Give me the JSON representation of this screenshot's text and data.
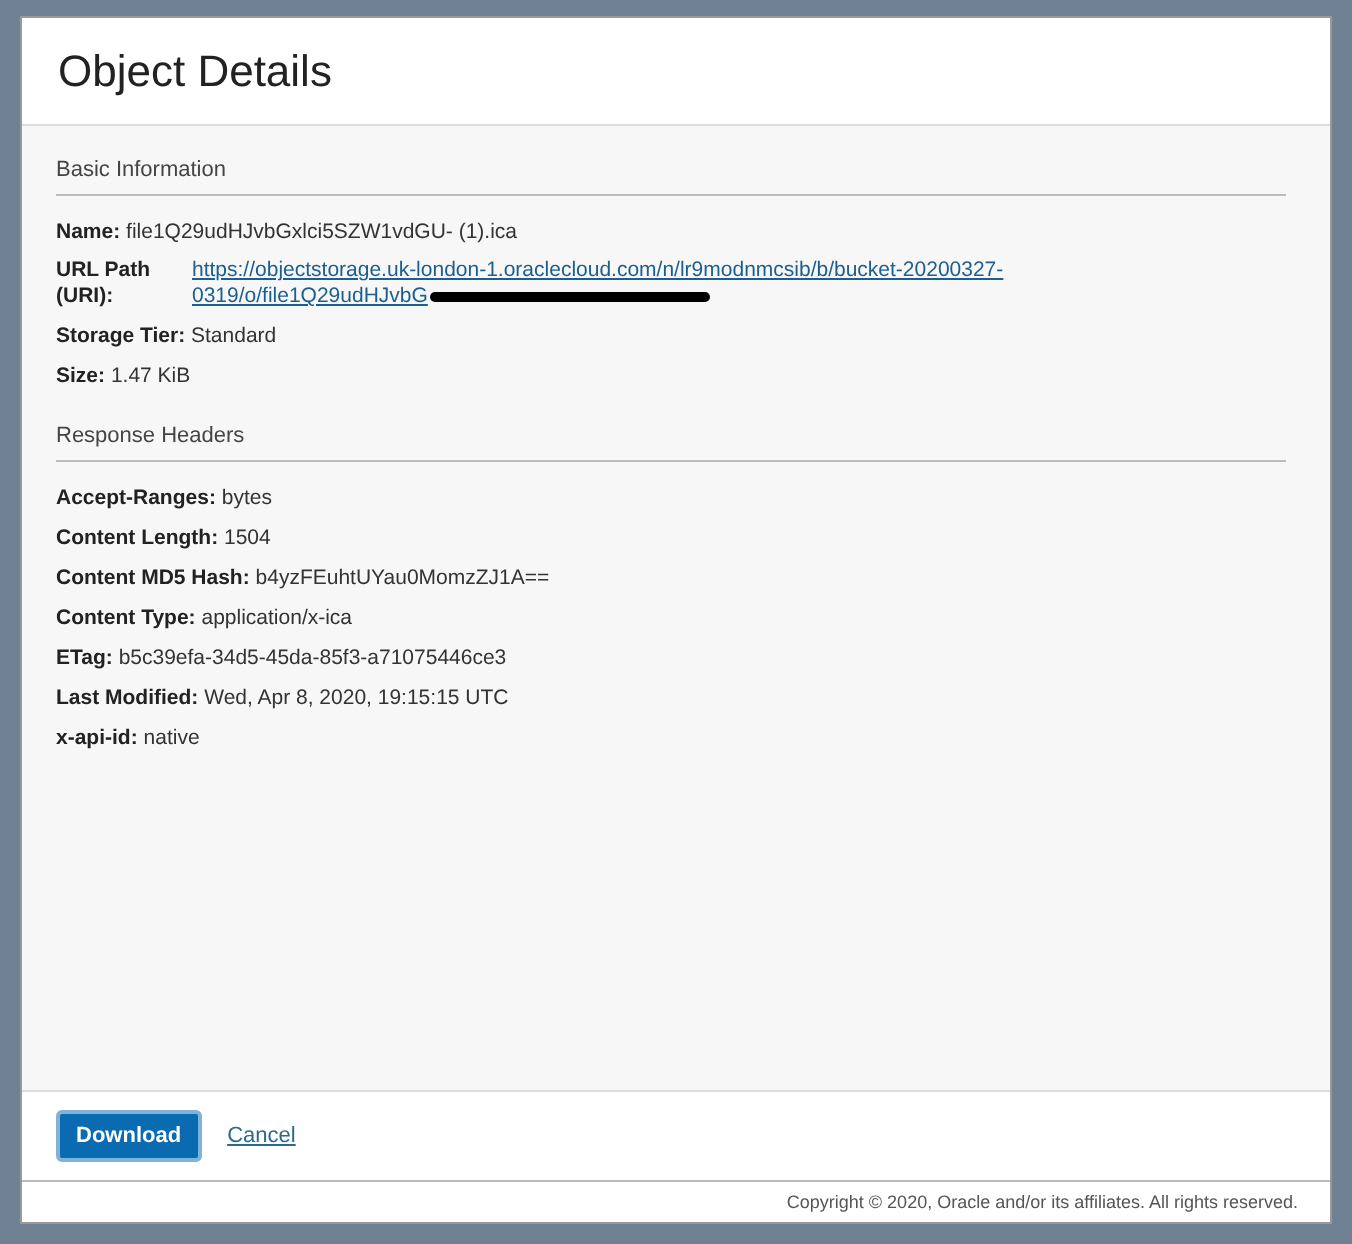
{
  "dialog": {
    "title": "Object Details"
  },
  "sections": [
    {
      "heading": "Basic Information",
      "fields": [
        {
          "kind": "text",
          "label": "Name:",
          "value": "file1Q29udHJvbGxlci5SZW1vdGU- (1).ica"
        },
        {
          "kind": "link",
          "label": "URL Path (URI):",
          "lines": [
            "https://objectstorage.uk-london-1.oraclecloud.com/n/lr9modnmcsib/b/bucket-20200327-",
            "0319/o/file1Q29udHJvbG"
          ],
          "redacted": true
        },
        {
          "kind": "text",
          "label": "Storage Tier:",
          "value": "Standard"
        },
        {
          "kind": "text",
          "label": "Size:",
          "value": "1.47 KiB"
        }
      ]
    },
    {
      "heading": "Response Headers",
      "fields": [
        {
          "kind": "text",
          "label": "Accept-Ranges:",
          "value": "bytes"
        },
        {
          "kind": "text",
          "label": "Content Length:",
          "value": "1504"
        },
        {
          "kind": "text",
          "label": "Content MD5 Hash:",
          "value": "b4yzFEuhtUYau0MomzZJ1A=="
        },
        {
          "kind": "text",
          "label": "Content Type:",
          "value": "application/x-ica"
        },
        {
          "kind": "text",
          "label": "ETag:",
          "value": "b5c39efa-34d5-45da-85f3-a71075446ce3"
        },
        {
          "kind": "text",
          "label": "Last Modified:",
          "value": "Wed, Apr 8, 2020, 19:15:15 UTC"
        },
        {
          "kind": "text",
          "label": "x-api-id:",
          "value": "native"
        }
      ]
    }
  ],
  "actions": {
    "primary": "Download",
    "cancel": "Cancel"
  },
  "copyright": "Copyright © 2020, Oracle and/or its affiliates. All rights reserved."
}
